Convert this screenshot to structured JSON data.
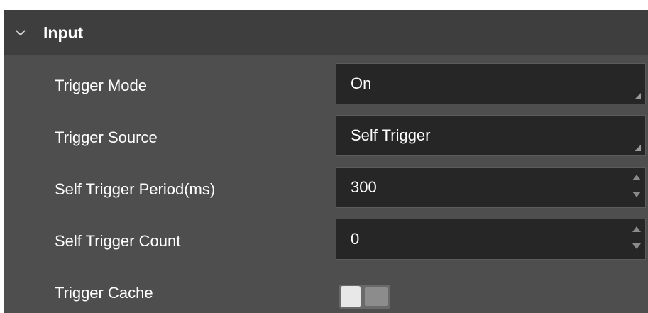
{
  "section": {
    "title": "Input",
    "icon": "chevron-down-icon",
    "expanded": true
  },
  "rows": [
    {
      "label": "Trigger Mode",
      "type": "combo",
      "value": "On"
    },
    {
      "label": "Trigger Source",
      "type": "combo",
      "value": "Self Trigger"
    },
    {
      "label": "Self Trigger Period(ms)",
      "type": "spinbox",
      "value": "300"
    },
    {
      "label": "Self Trigger Count",
      "type": "spinbox",
      "value": "0"
    },
    {
      "label": "Trigger Cache",
      "type": "toggle",
      "value": false
    }
  ],
  "colors": {
    "panel_bg": "#4e4e4e",
    "header_bg": "#3e3e3e",
    "field_bg": "#262626",
    "text": "#ffffff"
  }
}
